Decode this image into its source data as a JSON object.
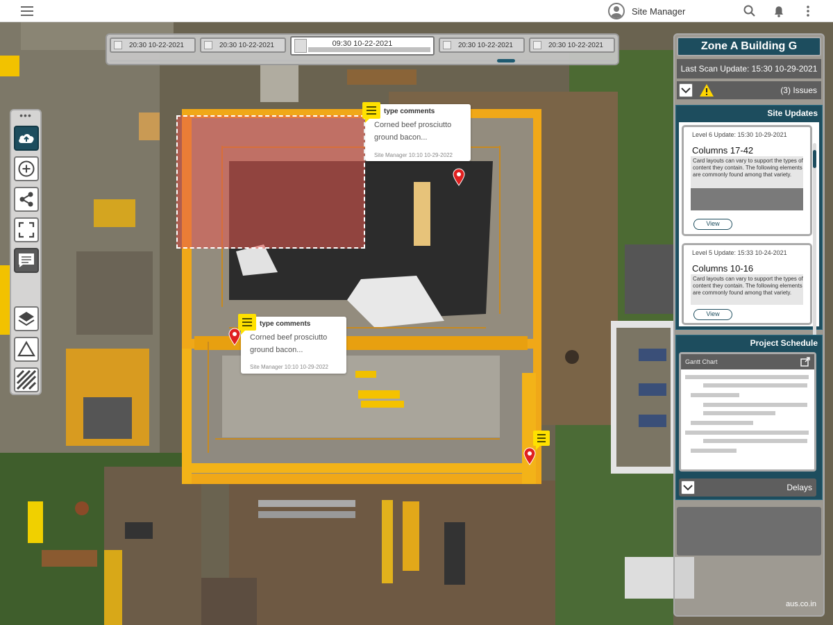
{
  "topbar": {
    "user_name": "Site Manager",
    "icons": [
      "menu-icon",
      "user-icon",
      "search-icon",
      "bell-icon",
      "more-vertical-icon"
    ]
  },
  "timeline": {
    "snapshots": [
      {
        "label": "20:30 10-22-2021",
        "active": false
      },
      {
        "label": "20:30 10-22-2021",
        "active": false
      },
      {
        "label": "09:30 10-22-2021",
        "active": true
      },
      {
        "label": "20:30 10-22-2021",
        "active": false
      },
      {
        "label": "20:30 10-22-2021",
        "active": false
      }
    ]
  },
  "toolbar": {
    "buttons": [
      "upload-cloud-icon",
      "add-circle-icon",
      "share-icon",
      "fullscreen-icon",
      "comment-icon",
      "layers-icon",
      "triangle-icon",
      "hatch-pattern-icon"
    ]
  },
  "comments": [
    {
      "title": "type comments",
      "body": "Corned beef prosciutto ground bacon...",
      "meta": "Site Manager 10:10 10-29-2022"
    },
    {
      "title": "type comments",
      "body": "Corned beef prosciutto ground bacon...",
      "meta": "Site Manager 10:10 10-29-2022"
    }
  ],
  "panel": {
    "zone_title": "Zone A Building G",
    "last_scan": "Last Scan Update: 15:30 10-29-2021",
    "issues": "(3) Issues",
    "site_updates": {
      "heading": "Site Updates",
      "cards": [
        {
          "meta": "Level 6 Update: 15:30 10-29-2021",
          "title": "Columns 17-42",
          "text": "Card layouts can vary to support the types of content they contain. The following elements are commonly found among that variety.",
          "button": "View"
        },
        {
          "meta": "Level 5 Update: 15:33 10-24-2021",
          "title": "Columns 10-16",
          "text": "Card layouts can vary to support the types of content they contain. The following elements are commonly found among that variety.",
          "button": "View"
        }
      ]
    },
    "project_schedule": {
      "heading": "Project Schedule",
      "gantt_label": "Gantt Chart",
      "delays_label": "Delays"
    },
    "footer": "aus.co.in"
  },
  "colors": {
    "accent": "#1d4d5e",
    "comment_yellow": "#ffe100",
    "pin_red": "#e02020",
    "selection": "#e65a50",
    "warning": "#ffd600"
  }
}
